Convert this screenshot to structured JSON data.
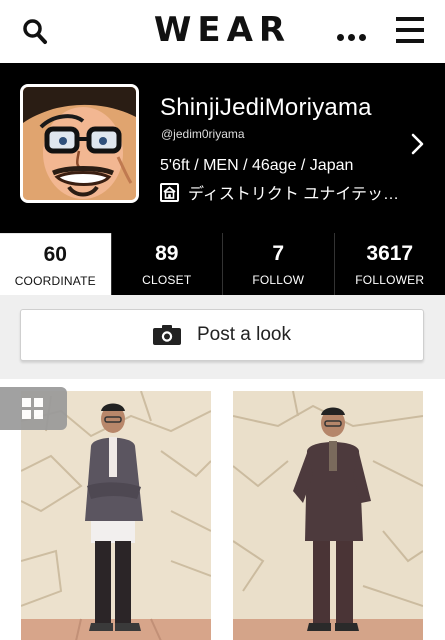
{
  "header": {
    "logo": "WEAR",
    "icons": [
      "search-icon",
      "more-icon",
      "menu-icon"
    ]
  },
  "profile": {
    "username": "ShinjiJediMoriyama",
    "handle": "@jedim0riyama",
    "details": "5'6ft / MEN / 46age / Japan",
    "shop": "ディストリクト ユナイテッ…"
  },
  "tabs": [
    {
      "count": "60",
      "label": "COORDINATE"
    },
    {
      "count": "89",
      "label": "CLOSET"
    },
    {
      "count": "7",
      "label": "FOLLOW"
    },
    {
      "count": "3617",
      "label": "FOLLOWER"
    }
  ],
  "post_button": {
    "label": "Post a look"
  },
  "colors": {
    "header_bg": "#ffffff",
    "profile_bg": "#000000",
    "band_bg": "#efefef"
  }
}
